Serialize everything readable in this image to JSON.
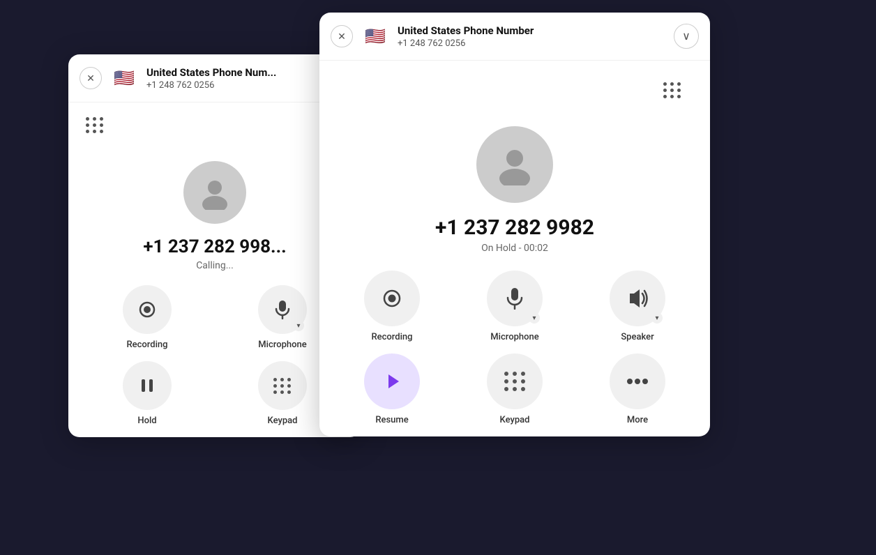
{
  "backCard": {
    "closeLabel": "✕",
    "flagEmoji": "🇺🇸",
    "headerName": "United States Phone Num...",
    "headerNumber": "+1 248 762 0256",
    "callNumber": "+1 237 282 998...",
    "callStatus": "Calling...",
    "controls": [
      {
        "id": "recording",
        "label": "Recording",
        "icon": "recording"
      },
      {
        "id": "microphone",
        "label": "Microphone",
        "icon": "microphone"
      },
      {
        "id": "hold",
        "label": "Hold",
        "icon": "hold"
      },
      {
        "id": "keypad",
        "label": "Keypad",
        "icon": "keypad"
      }
    ]
  },
  "frontCard": {
    "closeLabel": "✕",
    "flagEmoji": "🇺🇸",
    "headerName": "United States Phone Number",
    "headerNumber": "+1 248 762 0256",
    "chevronLabel": "∨",
    "callNumber": "+1 237 282 9982",
    "callStatus": "On Hold - 00:02",
    "controls": [
      {
        "id": "recording",
        "label": "Recording",
        "icon": "recording"
      },
      {
        "id": "microphone",
        "label": "Microphone",
        "icon": "microphone",
        "hasChevron": true
      },
      {
        "id": "speaker",
        "label": "Speaker",
        "icon": "speaker",
        "hasChevron": true
      },
      {
        "id": "resume",
        "label": "Resume",
        "icon": "resume",
        "accent": true
      },
      {
        "id": "keypad",
        "label": "Keypad",
        "icon": "keypad"
      },
      {
        "id": "more",
        "label": "More",
        "icon": "more"
      }
    ]
  }
}
